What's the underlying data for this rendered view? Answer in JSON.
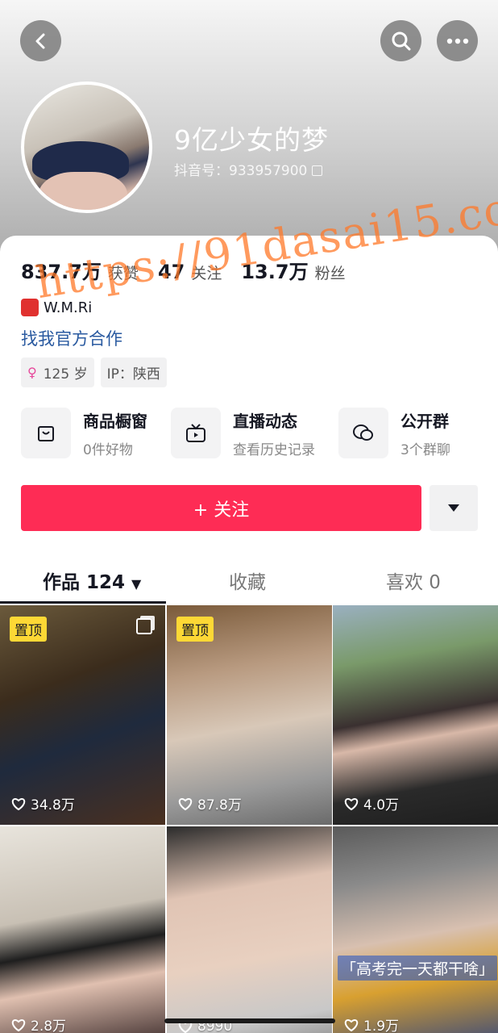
{
  "profile": {
    "nickname": "9亿少女的梦",
    "douyin_id": "抖音号：933957900"
  },
  "stats": [
    {
      "value": "837.7万",
      "label": "获赞"
    },
    {
      "value": "47",
      "label": "关注"
    },
    {
      "value": "13.7万",
      "label": "粉丝"
    }
  ],
  "signature": "W.M.Ri",
  "collab_link": "找我官方合作",
  "tags": {
    "age": "125 岁",
    "ip": "IP：陕西"
  },
  "entries": [
    {
      "title": "商品橱窗",
      "subtitle": "0件好物",
      "icon": "shopping-bag-icon"
    },
    {
      "title": "直播动态",
      "subtitle": "查看历史记录",
      "icon": "tv-icon"
    },
    {
      "title": "公开群",
      "subtitle": "3个群聊",
      "icon": "chat-group-icon"
    }
  ],
  "actions": {
    "follow": "+ 关注"
  },
  "tabs": [
    {
      "label": "作品 124"
    },
    {
      "label": "收藏"
    },
    {
      "label": "喜欢 0"
    }
  ],
  "videos": [
    {
      "likes": "34.8万",
      "pinned": "置顶",
      "multi_image": true
    },
    {
      "likes": "87.8万",
      "pinned": "置顶"
    },
    {
      "likes": "4.0万"
    },
    {
      "likes": "2.8万"
    },
    {
      "likes": "8990"
    },
    {
      "likes": "1.9万",
      "caption": "「高考完一天都干啥」"
    }
  ],
  "watermark": "https://91dasai15.com",
  "colors": {
    "accent": "#fe2c55",
    "link": "#2a5aa0",
    "pin": "#fdd835"
  }
}
